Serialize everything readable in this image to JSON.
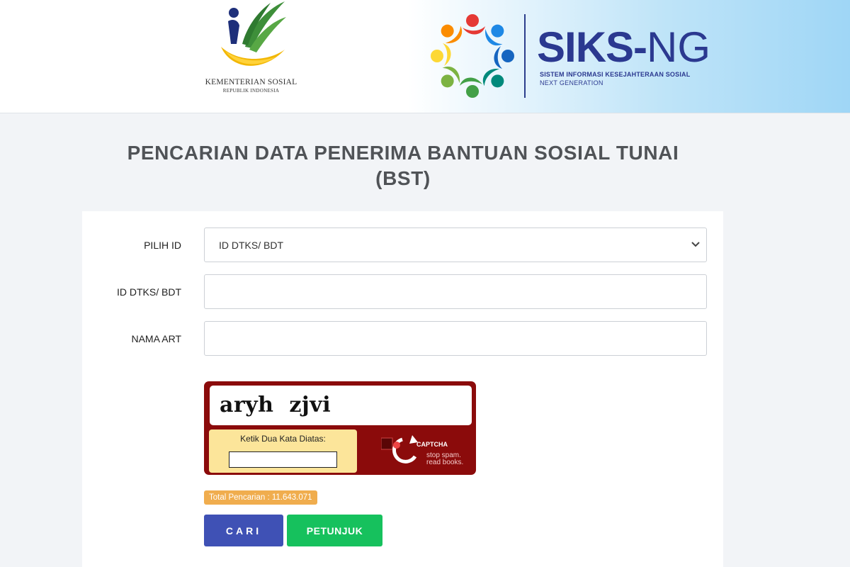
{
  "header": {
    "ministry_name": "KEMENTERIAN SOSIAL",
    "ministry_sub": "REPUBLIK INDONESIA",
    "app_name_main": "SIKS-",
    "app_name_suffix": "NG",
    "app_tagline": "SISTEM INFORMASI KESEJAHTERAAN SOSIAL",
    "app_tagline2": "NEXT GENERATION"
  },
  "page": {
    "title_line1": "PENCARIAN DATA PENERIMA BANTUAN SOSIAL TUNAI",
    "title_line2": "(BST)"
  },
  "form": {
    "pilih_id_label": "PILIH ID",
    "pilih_id_selected": "ID DTKS/ BDT",
    "id_label": "ID DTKS/ BDT",
    "id_value": "",
    "nama_label": "NAMA ART",
    "nama_value": ""
  },
  "captcha": {
    "words": "aryh  zjvi",
    "prompt": "Ketik Dua Kata Diatas:",
    "input_value": "",
    "brand": "CAPTCHA",
    "tagline1": "stop spam.",
    "tagline2": "read books."
  },
  "stats": {
    "total_label": "Total Pencarian : 11.643.071"
  },
  "buttons": {
    "search": "CARI",
    "help": "PETUNJUK"
  },
  "colors": {
    "brand_blue": "#2b3990",
    "search_button": "#3f51b5",
    "help_button": "#16c15d",
    "badge": "#f0ad4e",
    "captcha_bg": "#8b0b0b",
    "captcha_box": "#fce59a"
  }
}
